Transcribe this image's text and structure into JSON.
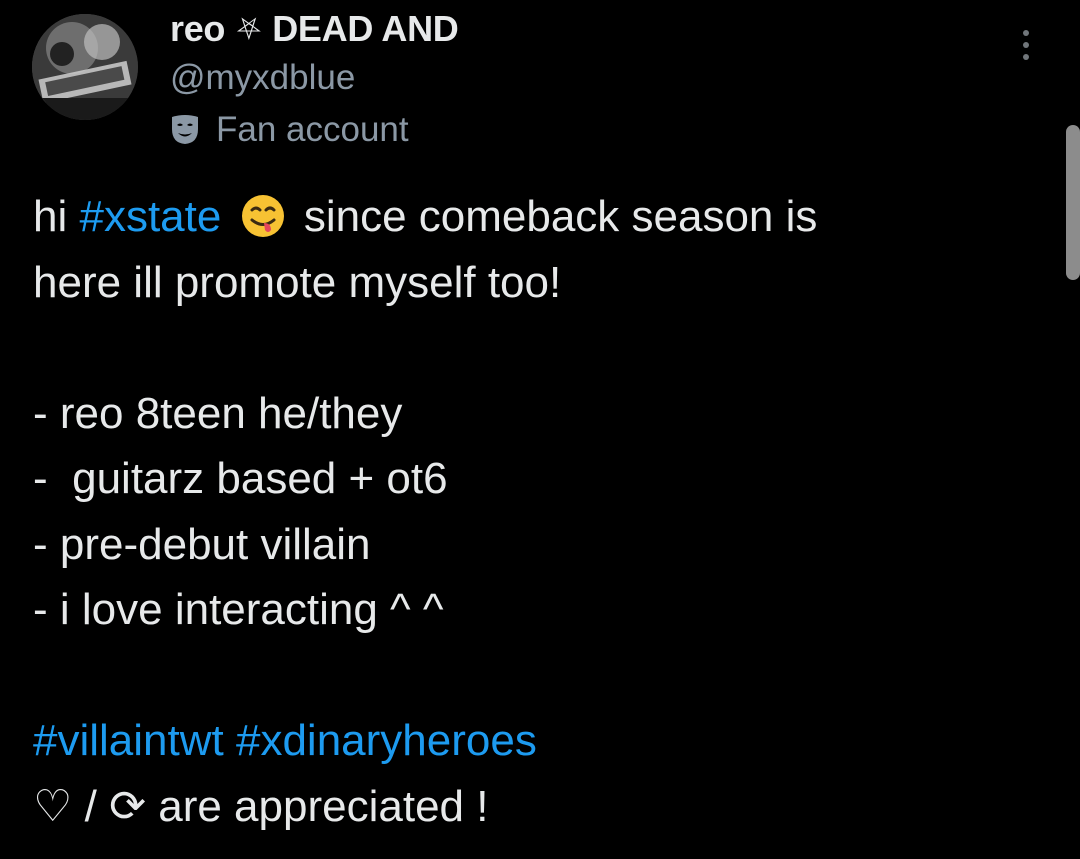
{
  "author": {
    "display_name_prefix": "reo",
    "name_symbol": "⛧",
    "display_name_suffix": "DEAD AND",
    "handle": "@myxdblue",
    "label_icon": "theater-mask-icon",
    "label": "Fan account"
  },
  "menu": {
    "icon": "more-vertical-icon"
  },
  "tweet": {
    "line1": {
      "pre": "hi ",
      "hashtag": "#xstate",
      "emoji": "face-savoring-food-emoji",
      "post": " since comeback season is"
    },
    "line2": "here ill promote myself too!",
    "line3": "",
    "line4": "- reo 8teen he/they",
    "line5": "-  guitarz based + ot6",
    "line6": "- pre-debut villain",
    "line7": "- i love interacting ^ ^",
    "line8": "",
    "hashtags": {
      "first": "#villaintwt",
      "space": " ",
      "second": "#xdinaryheroes"
    },
    "last": {
      "heart": "♡",
      "slash": " / ",
      "retweet_symbol": "⟳",
      "post": " are appreciated !"
    }
  },
  "colors": {
    "background": "#000000",
    "text": "#e7e9ea",
    "secondary": "#8b98a5",
    "link": "#1d9bf0"
  }
}
